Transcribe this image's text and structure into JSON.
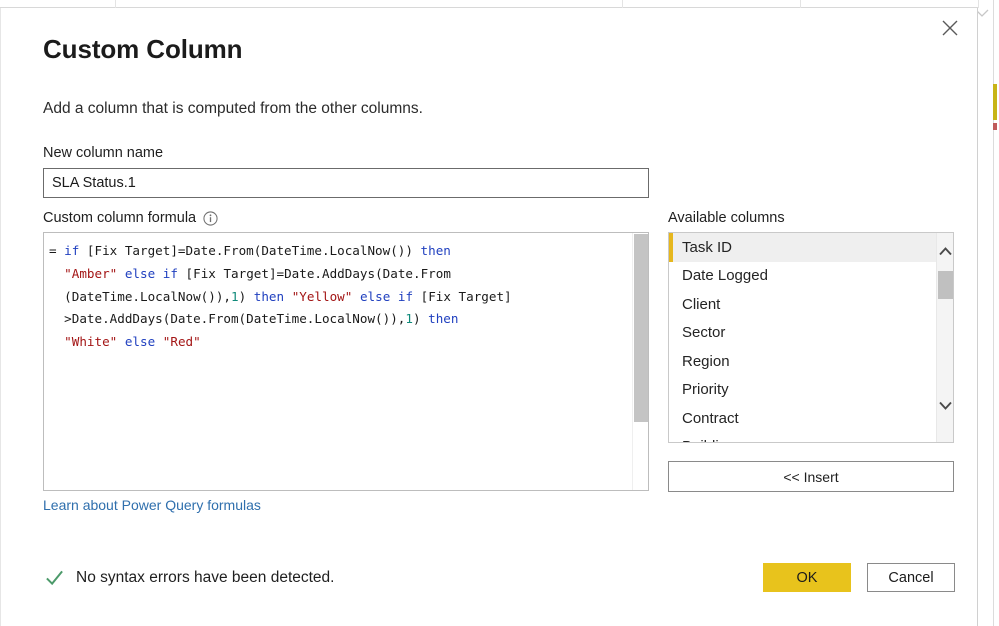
{
  "dialog": {
    "title": "Custom Column",
    "subtitle": "Add a column that is computed from the other columns.",
    "close_label": "Close"
  },
  "new_column": {
    "label": "New column name",
    "value": "SLA Status.1",
    "placeholder": ""
  },
  "formula": {
    "label": "Custom column formula",
    "info_icon": "info-icon",
    "tokens": [
      {
        "t": "= ",
        "c": "plain"
      },
      {
        "t": "if",
        "c": "kw"
      },
      {
        "t": " [Fix Target]=Date.From(DateTime.LocalNow()) ",
        "c": "plain"
      },
      {
        "t": "then",
        "c": "kw"
      },
      {
        "t": "\n  ",
        "c": "plain"
      },
      {
        "t": "\"Amber\"",
        "c": "str"
      },
      {
        "t": " ",
        "c": "plain"
      },
      {
        "t": "else",
        "c": "kw"
      },
      {
        "t": " ",
        "c": "plain"
      },
      {
        "t": "if",
        "c": "kw"
      },
      {
        "t": " [Fix Target]=Date.AddDays(Date.From\n  (DateTime.LocalNow()),",
        "c": "plain"
      },
      {
        "t": "1",
        "c": "num"
      },
      {
        "t": ") ",
        "c": "plain"
      },
      {
        "t": "then",
        "c": "kw"
      },
      {
        "t": " ",
        "c": "plain"
      },
      {
        "t": "\"Yellow\"",
        "c": "str"
      },
      {
        "t": " ",
        "c": "plain"
      },
      {
        "t": "else",
        "c": "kw"
      },
      {
        "t": " ",
        "c": "plain"
      },
      {
        "t": "if",
        "c": "kw"
      },
      {
        "t": " [Fix Target]\n  >Date.AddDays(Date.From(DateTime.LocalNow()),",
        "c": "plain"
      },
      {
        "t": "1",
        "c": "num"
      },
      {
        "t": ") ",
        "c": "plain"
      },
      {
        "t": "then",
        "c": "kw"
      },
      {
        "t": "\n  ",
        "c": "plain"
      },
      {
        "t": "\"White\"",
        "c": "str"
      },
      {
        "t": " ",
        "c": "plain"
      },
      {
        "t": "else",
        "c": "kw"
      },
      {
        "t": " ",
        "c": "plain"
      },
      {
        "t": "\"Red\"",
        "c": "str"
      }
    ],
    "plain_text": "= if [Fix Target]=Date.From(DateTime.LocalNow()) then \"Amber\" else if [Fix Target]=Date.AddDays(Date.From(DateTime.LocalNow()),1) then \"Yellow\" else if [Fix Target]>Date.AddDays(Date.From(DateTime.LocalNow()),1) then \"White\" else \"Red\""
  },
  "learn_link": "Learn about Power Query formulas",
  "status": {
    "icon": "check-icon",
    "text": "No syntax errors have been detected."
  },
  "available_columns": {
    "label": "Available columns",
    "selected_index": 0,
    "items": [
      {
        "label": "Task ID"
      },
      {
        "label": "Date Logged"
      },
      {
        "label": "Client"
      },
      {
        "label": "Sector"
      },
      {
        "label": "Region"
      },
      {
        "label": "Priority"
      },
      {
        "label": "Contract"
      },
      {
        "label": "Building"
      }
    ],
    "scroll_up_icon": "chevron-up-icon",
    "scroll_down_icon": "chevron-down-icon"
  },
  "buttons": {
    "insert": "<< Insert",
    "ok": "OK",
    "cancel": "Cancel"
  },
  "colors": {
    "accent_yellow": "#e8c31c",
    "selected_bar": "#e6b71e",
    "keyword": "#1f3fbf",
    "string": "#a31515",
    "number": "#0f8a7a",
    "link": "#2f6fad",
    "check_green": "#4c9a6a"
  }
}
